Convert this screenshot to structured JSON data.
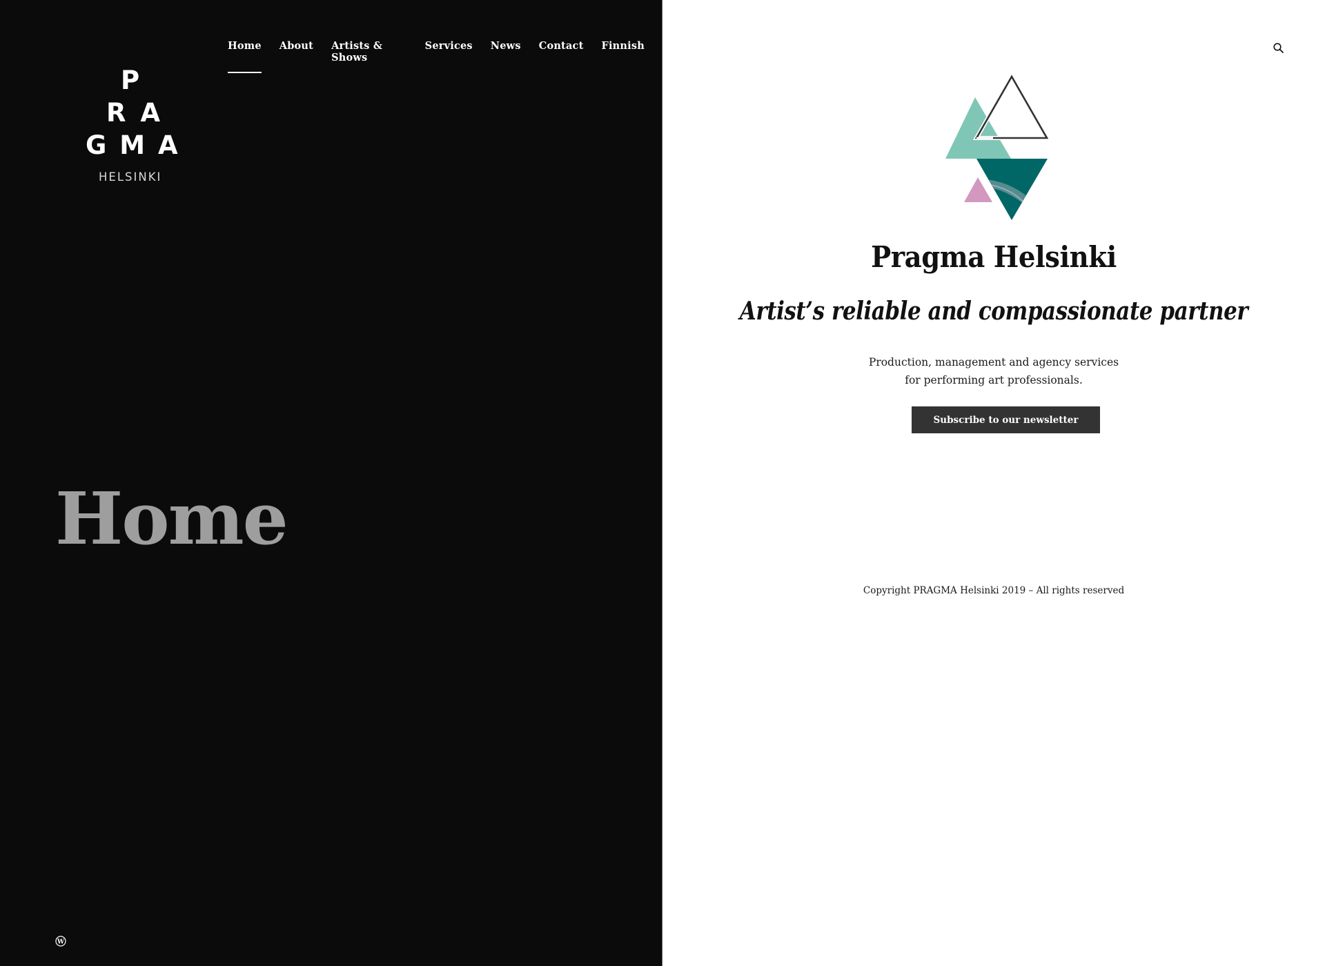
{
  "nav": {
    "items": [
      {
        "label": "Home",
        "active": true
      },
      {
        "label": "About"
      },
      {
        "label": "Artists & Shows"
      },
      {
        "label": "Services"
      },
      {
        "label": "News"
      },
      {
        "label": "Contact"
      },
      {
        "label": "Finnish"
      }
    ]
  },
  "logo": {
    "rows": [
      "P",
      "R A",
      "G M A"
    ],
    "subtitle": "HELSINKI"
  },
  "page": {
    "heading": "Home"
  },
  "hero": {
    "site_title": "Pragma Helsinki",
    "tagline": "Artist’s reliable and compassionate partner",
    "description_line1": "Production, management and agency services",
    "description_line2": "for performing art professionals.",
    "subscribe_label": "Subscribe to our newsletter"
  },
  "footer": {
    "copyright": "Copyright PRAGMA Helsinki 2019 – All rights reserved"
  },
  "icons": {
    "search": "search-icon",
    "wordpress": "wordpress-icon"
  },
  "colors": {
    "left_panel_bg": "#0b0b0b",
    "right_panel_bg": "#ffffff",
    "button_bg": "#333333",
    "heading_gray": "#9e9e9e",
    "teal_light": "#80C6B6",
    "teal_dark": "#006666",
    "pink": "#D398C0",
    "outline": "#333333"
  }
}
